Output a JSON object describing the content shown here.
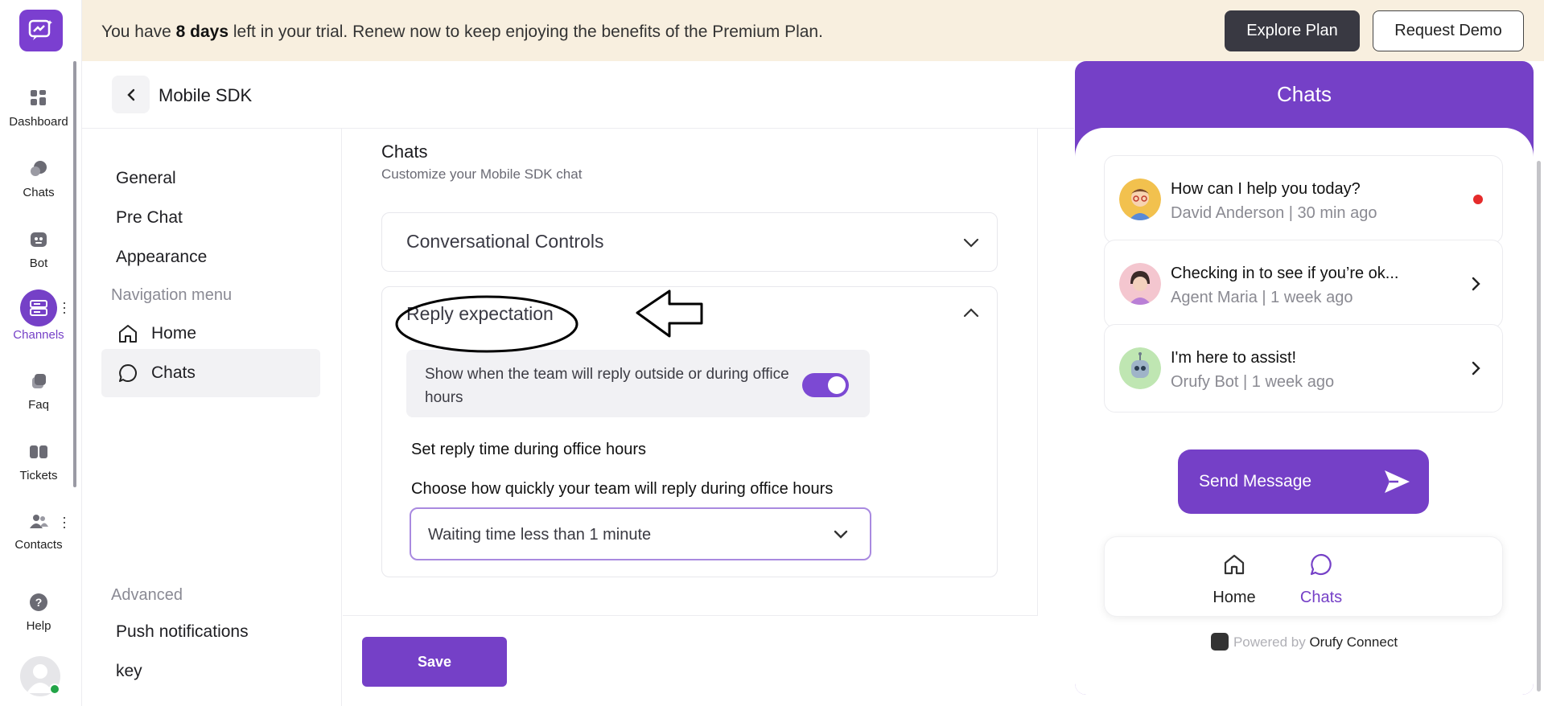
{
  "rail": {
    "items": [
      {
        "label": "Dashboard",
        "icon": "dashboard-icon"
      },
      {
        "label": "Chats",
        "icon": "chats-icon"
      },
      {
        "label": "Bot",
        "icon": "bot-icon"
      },
      {
        "label": "Channels",
        "icon": "channels-icon",
        "active": true
      },
      {
        "label": "Faq",
        "icon": "faq-icon"
      },
      {
        "label": "Tickets",
        "icon": "tickets-icon"
      },
      {
        "label": "Contacts",
        "icon": "contacts-icon"
      },
      {
        "label": "Help",
        "icon": "help-icon"
      }
    ],
    "accent": "#7540c7"
  },
  "banner": {
    "text_pre": "You have ",
    "text_bold": "8 days",
    "text_post": " left in your trial. Renew now to keep enjoying the benefits of the Premium Plan.",
    "explore_label": "Explore Plan",
    "demo_label": "Request Demo"
  },
  "header": {
    "title": "Mobile SDK"
  },
  "settings_nav": {
    "items": [
      "General",
      "Pre Chat",
      "Appearance"
    ],
    "nav_menu_heading": "Navigation menu",
    "nav_menu": [
      {
        "label": "Home",
        "icon": "home-icon"
      },
      {
        "label": "Chats",
        "icon": "chat-bubble-icon",
        "active": true
      }
    ],
    "advanced_heading": "Advanced",
    "advanced": [
      "Push notifications",
      "key"
    ]
  },
  "main": {
    "title": "Chats",
    "subtitle": "Customize your Mobile SDK chat",
    "conversational_controls": "Conversational Controls",
    "reply_expectation": "Reply expectation",
    "toggle_text": "Show when the team will reply outside or during office hours",
    "toggle_on": true,
    "set_reply_time": "Set reply time during office hours",
    "choose_label": "Choose how quickly your team will reply during office hours",
    "select_value": "Waiting time less than 1 minute",
    "save_label": "Save"
  },
  "preview": {
    "title": "Chats",
    "chats": [
      {
        "title": "How can I help you today?",
        "meta": "David Anderson | 30 min ago",
        "unread": true,
        "avatar_color": "#f2c14e"
      },
      {
        "title": "Checking in to see if you’re ok...",
        "meta": "Agent Maria | 1 week ago",
        "unread": false,
        "avatar_color": "#f4c6cf"
      },
      {
        "title": "I'm here to assist!",
        "meta": "Orufy Bot | 1 week ago",
        "unread": false,
        "avatar_color": "#bfe6b2"
      }
    ],
    "send_label": "Send Message",
    "nav_home": "Home",
    "nav_chats": "Chats",
    "powered_prefix": "Powered by",
    "powered_brand": "Orufy Connect"
  }
}
